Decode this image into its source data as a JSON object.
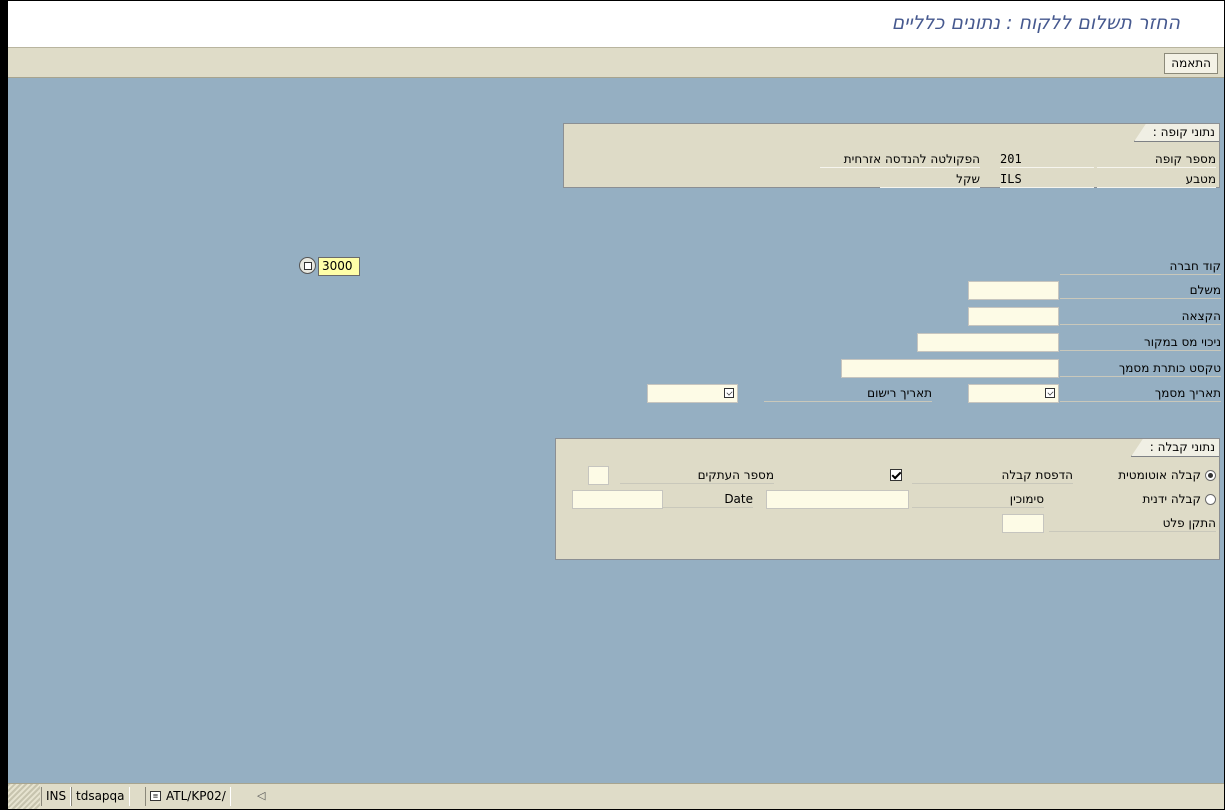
{
  "window": {
    "title": "החזר תשלום ללקוח : נתונים כלליים"
  },
  "toolbar": {
    "adjust_label": "התאמה"
  },
  "cash_group": {
    "title": "נתוני קופה :",
    "rows": [
      {
        "label": "מספר קופה",
        "code": "201",
        "desc": "הפקולטה להנדסה אזרחית"
      },
      {
        "label": "מטבע",
        "code": "ILS",
        "desc": "שקל"
      }
    ]
  },
  "form": {
    "company_code_label": "קוד חברה",
    "company_code_value": "3000",
    "payer_label": "משלם",
    "payer_value": "",
    "allocation_label": "הקצאה",
    "allocation_value": "",
    "withholding_label": "ניכוי מס במקור",
    "withholding_value": "",
    "header_text_label": "טקסט כותרת מסמך",
    "header_text_value": "",
    "doc_date_label": "תאריך מסמך",
    "doc_date_value": "",
    "posting_date_label": "תאריך רישום",
    "posting_date_value": ""
  },
  "receipt_group": {
    "title": "נתוני קבלה :",
    "auto_receipt_label": "קבלה אוטומטית",
    "auto_receipt_selected": true,
    "manual_receipt_label": "קבלה ידנית",
    "manual_receipt_selected": false,
    "print_receipt_label": "הדפסת קבלה",
    "print_receipt_checked": true,
    "copies_label": "מספר העתקים",
    "copies_value": "",
    "reference_label": "סימוכין",
    "reference_value": "",
    "date_label": "Date",
    "date_value": "",
    "output_device_label": "התקן פלט",
    "output_device_value": ""
  },
  "statusbar": {
    "mode": "INS",
    "server": "tdsapqa",
    "transaction": "ATL/KP02/"
  },
  "colors": {
    "workarea": "#95afc2",
    "group_bg": "#dedbc7",
    "title_text": "#46598f",
    "field_bg": "#fdfbe6",
    "focused_field_bg": "#ffffa8"
  }
}
